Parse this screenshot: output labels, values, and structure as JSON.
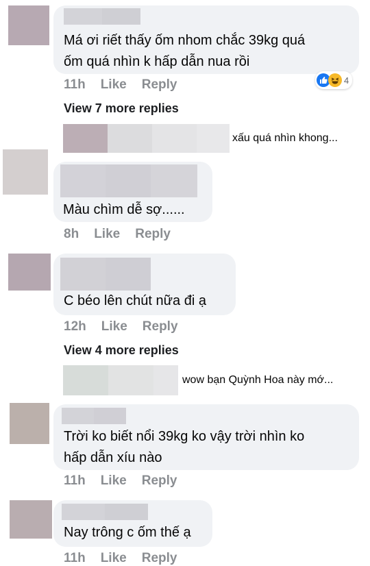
{
  "comments": [
    {
      "text_lines": [
        "Má ơi riết thấy ốm nhom chắc 39kg quá",
        "ốm quá nhìn k hấp dẫn nua rồi"
      ],
      "time": "11h",
      "like": "Like",
      "reply": "Reply",
      "reaction_count": "4",
      "more_replies": "View 7 more replies",
      "reply_snippet": "xấu quá nhìn khong..."
    },
    {
      "text_lines": [
        "Màu chìm dễ sợ......"
      ],
      "time": "8h",
      "like": "Like",
      "reply": "Reply"
    },
    {
      "text_lines": [
        "C béo lên chút nữa đi ạ"
      ],
      "time": "12h",
      "like": "Like",
      "reply": "Reply",
      "more_replies": "View 4 more replies",
      "reply_snippet": "wow bạn Quỳnh Hoa này mớ..."
    },
    {
      "text_lines": [
        "Trời ko biết nổi 39kg ko vậy trời nhìn ko",
        "hấp dẫn xíu nào"
      ],
      "time": "11h",
      "like": "Like",
      "reply": "Reply"
    },
    {
      "text_lines": [
        "Nay trông c ốm thế ạ"
      ],
      "time": "11h",
      "like": "Like",
      "reply": "Reply"
    }
  ],
  "colors": {
    "bubble": "#f0f2f5",
    "meta": "#8a8d91",
    "like_blue": "#1877f2",
    "haha_yellow": "#f7b928"
  }
}
